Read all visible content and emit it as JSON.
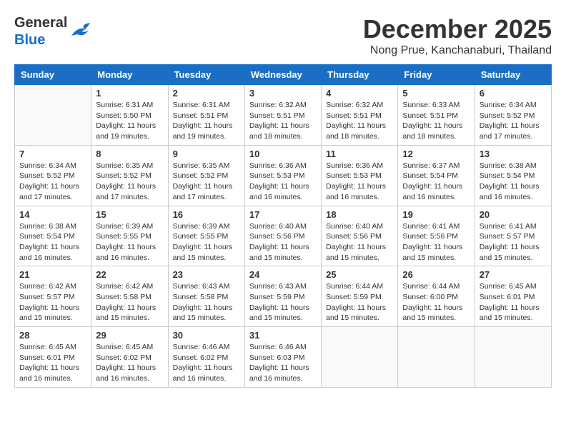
{
  "header": {
    "logo_line1": "General",
    "logo_line2": "Blue",
    "month_title": "December 2025",
    "location": "Nong Prue, Kanchanaburi, Thailand"
  },
  "weekdays": [
    "Sunday",
    "Monday",
    "Tuesday",
    "Wednesday",
    "Thursday",
    "Friday",
    "Saturday"
  ],
  "weeks": [
    [
      {
        "day": "",
        "sunrise": "",
        "sunset": "",
        "daylight": ""
      },
      {
        "day": "1",
        "sunrise": "Sunrise: 6:31 AM",
        "sunset": "Sunset: 5:50 PM",
        "daylight": "Daylight: 11 hours and 19 minutes."
      },
      {
        "day": "2",
        "sunrise": "Sunrise: 6:31 AM",
        "sunset": "Sunset: 5:51 PM",
        "daylight": "Daylight: 11 hours and 19 minutes."
      },
      {
        "day": "3",
        "sunrise": "Sunrise: 6:32 AM",
        "sunset": "Sunset: 5:51 PM",
        "daylight": "Daylight: 11 hours and 18 minutes."
      },
      {
        "day": "4",
        "sunrise": "Sunrise: 6:32 AM",
        "sunset": "Sunset: 5:51 PM",
        "daylight": "Daylight: 11 hours and 18 minutes."
      },
      {
        "day": "5",
        "sunrise": "Sunrise: 6:33 AM",
        "sunset": "Sunset: 5:51 PM",
        "daylight": "Daylight: 11 hours and 18 minutes."
      },
      {
        "day": "6",
        "sunrise": "Sunrise: 6:34 AM",
        "sunset": "Sunset: 5:52 PM",
        "daylight": "Daylight: 11 hours and 17 minutes."
      }
    ],
    [
      {
        "day": "7",
        "sunrise": "Sunrise: 6:34 AM",
        "sunset": "Sunset: 5:52 PM",
        "daylight": "Daylight: 11 hours and 17 minutes."
      },
      {
        "day": "8",
        "sunrise": "Sunrise: 6:35 AM",
        "sunset": "Sunset: 5:52 PM",
        "daylight": "Daylight: 11 hours and 17 minutes."
      },
      {
        "day": "9",
        "sunrise": "Sunrise: 6:35 AM",
        "sunset": "Sunset: 5:52 PM",
        "daylight": "Daylight: 11 hours and 17 minutes."
      },
      {
        "day": "10",
        "sunrise": "Sunrise: 6:36 AM",
        "sunset": "Sunset: 5:53 PM",
        "daylight": "Daylight: 11 hours and 16 minutes."
      },
      {
        "day": "11",
        "sunrise": "Sunrise: 6:36 AM",
        "sunset": "Sunset: 5:53 PM",
        "daylight": "Daylight: 11 hours and 16 minutes."
      },
      {
        "day": "12",
        "sunrise": "Sunrise: 6:37 AM",
        "sunset": "Sunset: 5:54 PM",
        "daylight": "Daylight: 11 hours and 16 minutes."
      },
      {
        "day": "13",
        "sunrise": "Sunrise: 6:38 AM",
        "sunset": "Sunset: 5:54 PM",
        "daylight": "Daylight: 11 hours and 16 minutes."
      }
    ],
    [
      {
        "day": "14",
        "sunrise": "Sunrise: 6:38 AM",
        "sunset": "Sunset: 5:54 PM",
        "daylight": "Daylight: 11 hours and 16 minutes."
      },
      {
        "day": "15",
        "sunrise": "Sunrise: 6:39 AM",
        "sunset": "Sunset: 5:55 PM",
        "daylight": "Daylight: 11 hours and 16 minutes."
      },
      {
        "day": "16",
        "sunrise": "Sunrise: 6:39 AM",
        "sunset": "Sunset: 5:55 PM",
        "daylight": "Daylight: 11 hours and 15 minutes."
      },
      {
        "day": "17",
        "sunrise": "Sunrise: 6:40 AM",
        "sunset": "Sunset: 5:56 PM",
        "daylight": "Daylight: 11 hours and 15 minutes."
      },
      {
        "day": "18",
        "sunrise": "Sunrise: 6:40 AM",
        "sunset": "Sunset: 5:56 PM",
        "daylight": "Daylight: 11 hours and 15 minutes."
      },
      {
        "day": "19",
        "sunrise": "Sunrise: 6:41 AM",
        "sunset": "Sunset: 5:56 PM",
        "daylight": "Daylight: 11 hours and 15 minutes."
      },
      {
        "day": "20",
        "sunrise": "Sunrise: 6:41 AM",
        "sunset": "Sunset: 5:57 PM",
        "daylight": "Daylight: 11 hours and 15 minutes."
      }
    ],
    [
      {
        "day": "21",
        "sunrise": "Sunrise: 6:42 AM",
        "sunset": "Sunset: 5:57 PM",
        "daylight": "Daylight: 11 hours and 15 minutes."
      },
      {
        "day": "22",
        "sunrise": "Sunrise: 6:42 AM",
        "sunset": "Sunset: 5:58 PM",
        "daylight": "Daylight: 11 hours and 15 minutes."
      },
      {
        "day": "23",
        "sunrise": "Sunrise: 6:43 AM",
        "sunset": "Sunset: 5:58 PM",
        "daylight": "Daylight: 11 hours and 15 minutes."
      },
      {
        "day": "24",
        "sunrise": "Sunrise: 6:43 AM",
        "sunset": "Sunset: 5:59 PM",
        "daylight": "Daylight: 11 hours and 15 minutes."
      },
      {
        "day": "25",
        "sunrise": "Sunrise: 6:44 AM",
        "sunset": "Sunset: 5:59 PM",
        "daylight": "Daylight: 11 hours and 15 minutes."
      },
      {
        "day": "26",
        "sunrise": "Sunrise: 6:44 AM",
        "sunset": "Sunset: 6:00 PM",
        "daylight": "Daylight: 11 hours and 15 minutes."
      },
      {
        "day": "27",
        "sunrise": "Sunrise: 6:45 AM",
        "sunset": "Sunset: 6:01 PM",
        "daylight": "Daylight: 11 hours and 15 minutes."
      }
    ],
    [
      {
        "day": "28",
        "sunrise": "Sunrise: 6:45 AM",
        "sunset": "Sunset: 6:01 PM",
        "daylight": "Daylight: 11 hours and 16 minutes."
      },
      {
        "day": "29",
        "sunrise": "Sunrise: 6:45 AM",
        "sunset": "Sunset: 6:02 PM",
        "daylight": "Daylight: 11 hours and 16 minutes."
      },
      {
        "day": "30",
        "sunrise": "Sunrise: 6:46 AM",
        "sunset": "Sunset: 6:02 PM",
        "daylight": "Daylight: 11 hours and 16 minutes."
      },
      {
        "day": "31",
        "sunrise": "Sunrise: 6:46 AM",
        "sunset": "Sunset: 6:03 PM",
        "daylight": "Daylight: 11 hours and 16 minutes."
      },
      {
        "day": "",
        "sunrise": "",
        "sunset": "",
        "daylight": ""
      },
      {
        "day": "",
        "sunrise": "",
        "sunset": "",
        "daylight": ""
      },
      {
        "day": "",
        "sunrise": "",
        "sunset": "",
        "daylight": ""
      }
    ]
  ]
}
